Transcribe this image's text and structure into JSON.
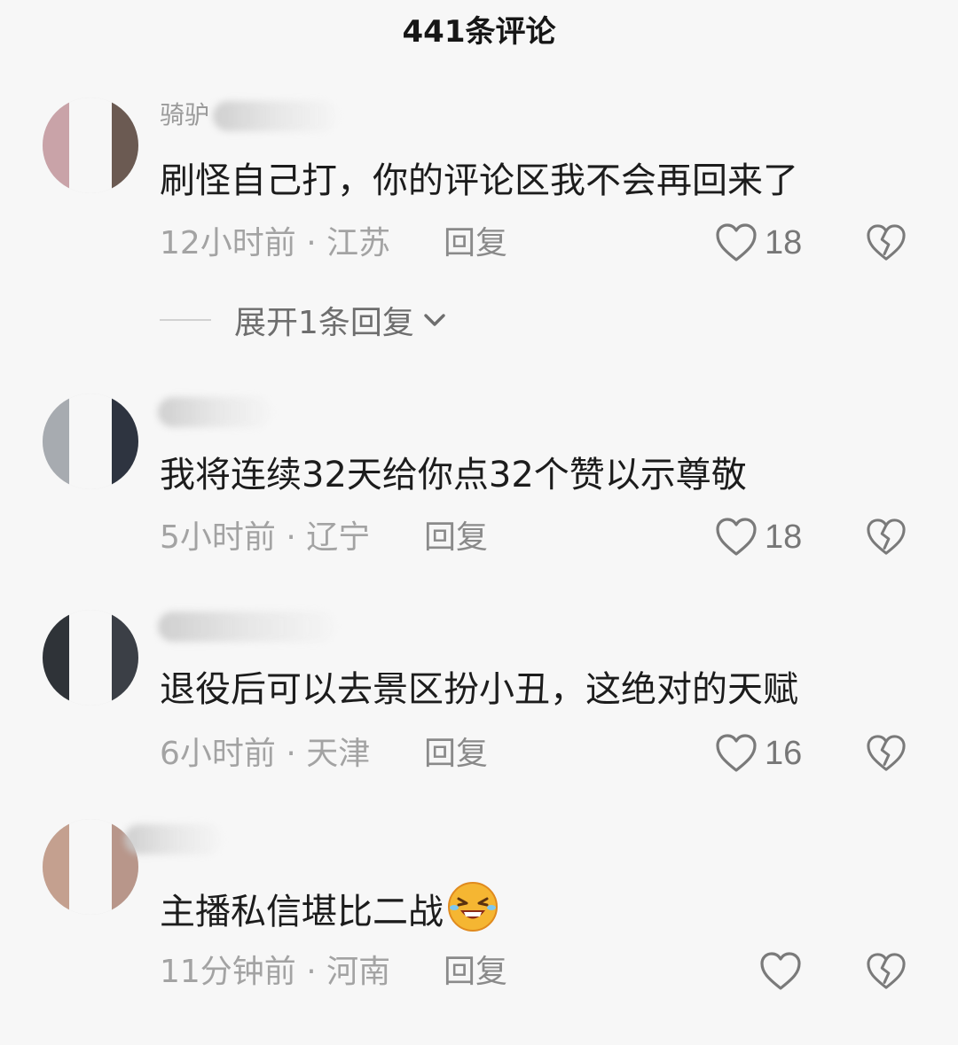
{
  "header": {
    "title": "441条评论"
  },
  "comments": [
    {
      "username_visible": "骑驴",
      "text": "刷怪自己打，你的评论区我不会再回来了",
      "time": "12小时前",
      "location": "江苏",
      "reply_label": "回复",
      "likes": "18",
      "expand_label": "展开1条回复",
      "avatar_color": "#c9a3a8"
    },
    {
      "username_visible": "",
      "text": "我将连续32天给你点32个赞以示尊敬",
      "time": "5小时前",
      "location": "辽宁",
      "reply_label": "回复",
      "likes": "18",
      "avatar_color": "#9aa3ad"
    },
    {
      "username_visible": "",
      "text": "退役后可以去景区扮小丑，这绝对的天赋",
      "time": "6小时前",
      "location": "天津",
      "reply_label": "回复",
      "likes": "16",
      "avatar_color": "#2f3338"
    },
    {
      "username_visible": "",
      "text": "主播私信堪比二战",
      "emoji": "laughing-crying-emoji",
      "time": "11分钟前",
      "location": "河南",
      "reply_label": "回复",
      "likes": "",
      "avatar_color": "#c4a08f"
    }
  ],
  "icons": {
    "like": "heart-outline-icon",
    "dislike": "broken-heart-icon",
    "expand": "chevron-down-icon"
  },
  "colors": {
    "background": "#f7f7f7",
    "meta_text": "#a3a3a3",
    "primary_text": "#1c1c1c"
  }
}
